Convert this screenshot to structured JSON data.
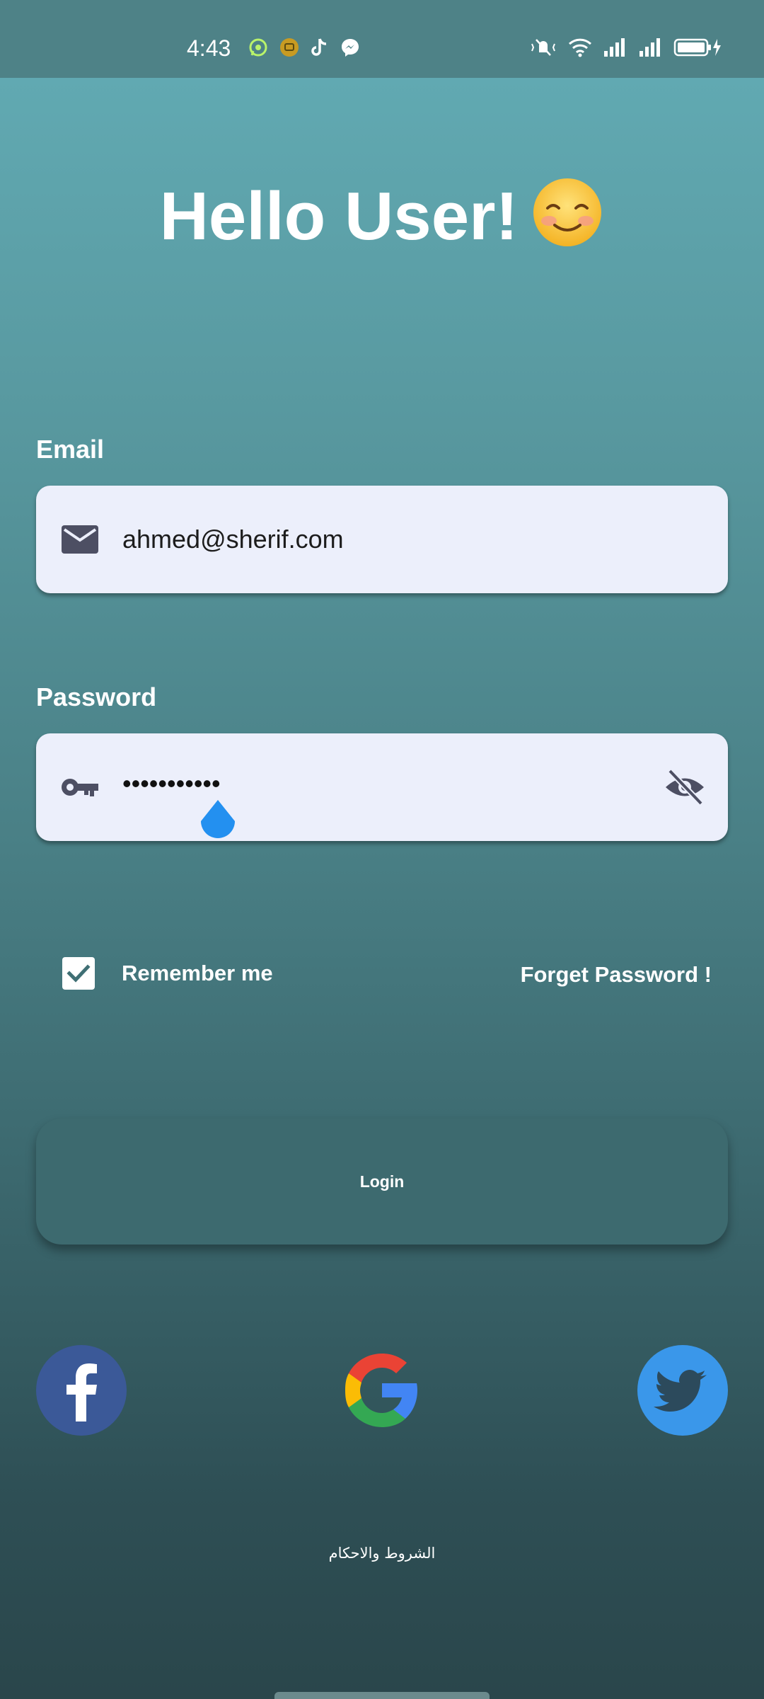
{
  "status_bar": {
    "time": "4:43"
  },
  "greeting": {
    "title": "Hello User!"
  },
  "email": {
    "label": "Email",
    "value": "ahmed@sherif.com"
  },
  "password": {
    "label": "Password",
    "masked_value": "•••••••••••"
  },
  "options": {
    "remember_label": "Remember me",
    "remember_checked": true,
    "forget_label": "Forget Password !"
  },
  "login": {
    "label": "Login"
  },
  "social": {
    "facebook_color": "#3b5998",
    "twitter_color": "#3a97ea"
  },
  "footer": {
    "terms_label": "الشروط والاحكام"
  },
  "colors": {
    "field_bg": "#eceffb",
    "icon_color": "#4d4f63",
    "cursor_handle": "#2390f0"
  }
}
